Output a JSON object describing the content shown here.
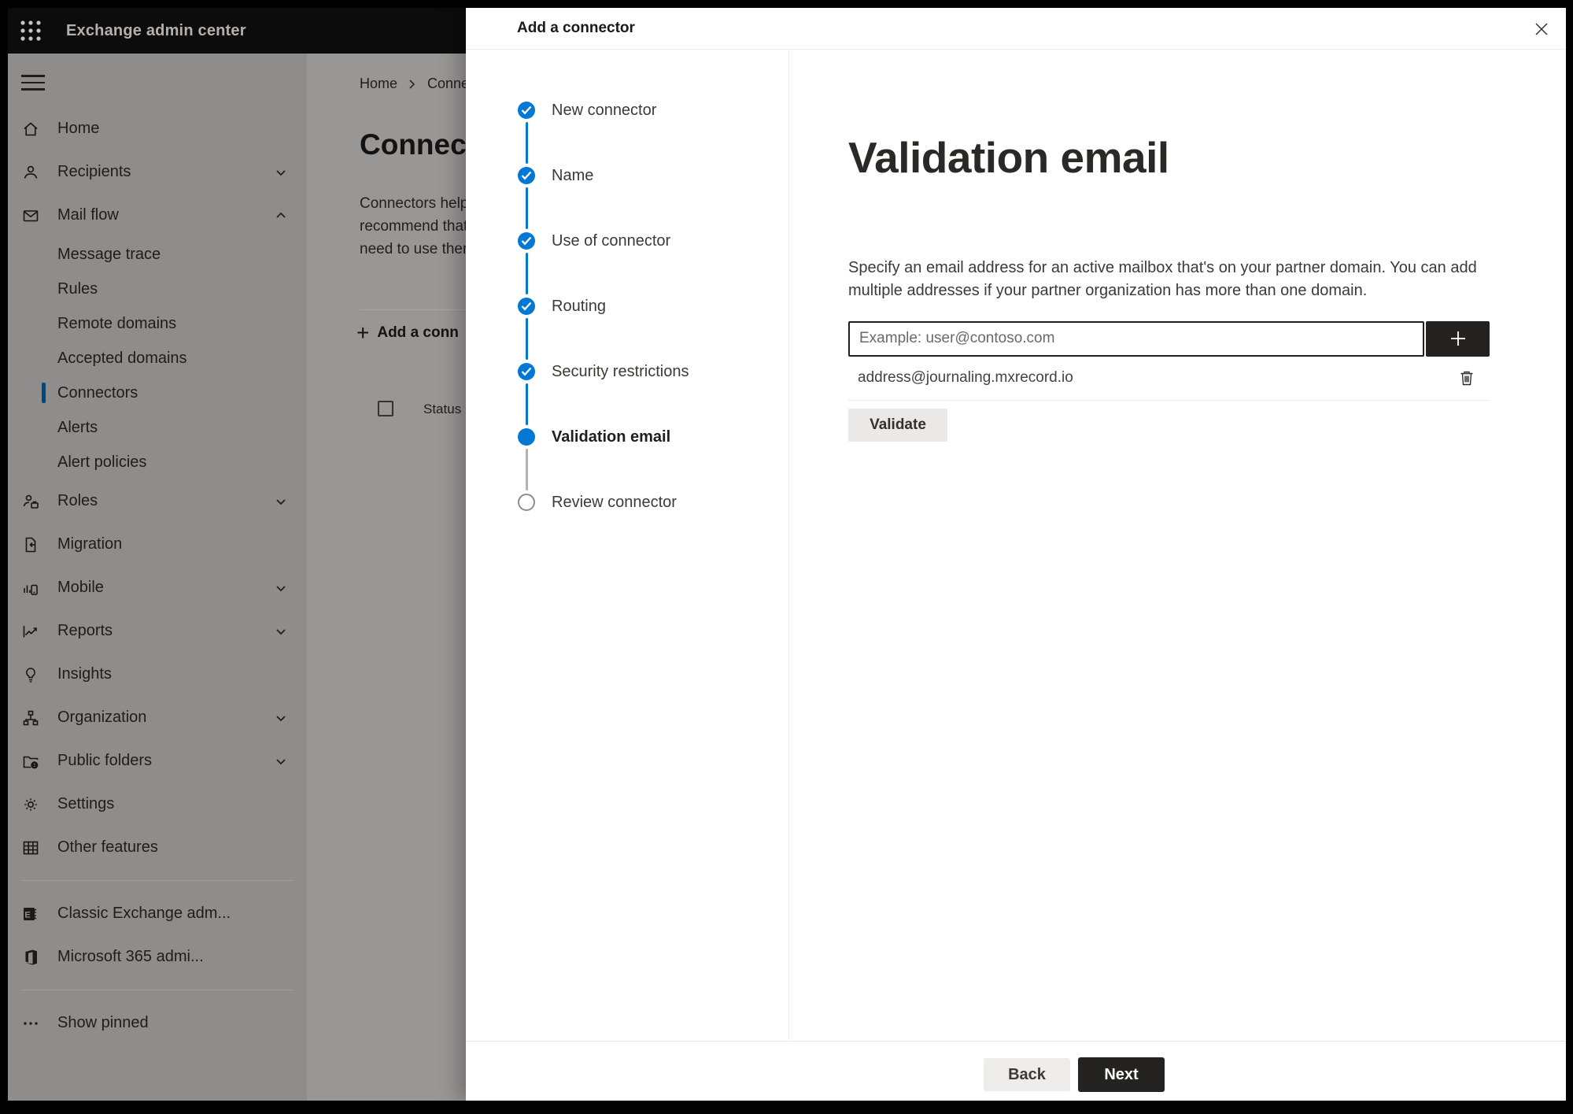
{
  "topbar": {
    "title": "Exchange admin center"
  },
  "sidebar": {
    "items": [
      {
        "label": "Home",
        "icon": "home",
        "type": "top"
      },
      {
        "label": "Recipients",
        "icon": "person",
        "type": "top",
        "chevron": "down"
      },
      {
        "label": "Mail flow",
        "icon": "mail",
        "type": "top",
        "chevron": "up"
      },
      {
        "label": "Message trace",
        "type": "sub"
      },
      {
        "label": "Rules",
        "type": "sub"
      },
      {
        "label": "Remote domains",
        "type": "sub"
      },
      {
        "label": "Accepted domains",
        "type": "sub"
      },
      {
        "label": "Connectors",
        "type": "sub",
        "selected": true
      },
      {
        "label": "Alerts",
        "type": "sub"
      },
      {
        "label": "Alert policies",
        "type": "sub"
      },
      {
        "label": "Roles",
        "icon": "person-briefcase",
        "type": "top",
        "chevron": "down"
      },
      {
        "label": "Migration",
        "icon": "migration",
        "type": "top"
      },
      {
        "label": "Mobile",
        "icon": "mobile",
        "type": "top",
        "chevron": "down"
      },
      {
        "label": "Reports",
        "icon": "chart",
        "type": "top",
        "chevron": "down"
      },
      {
        "label": "Insights",
        "icon": "lightbulb",
        "type": "top"
      },
      {
        "label": "Organization",
        "icon": "org-tree",
        "type": "top",
        "chevron": "down"
      },
      {
        "label": "Public folders",
        "icon": "folder-globe",
        "type": "top",
        "chevron": "down"
      },
      {
        "label": "Settings",
        "icon": "gear",
        "type": "top"
      },
      {
        "label": "Other features",
        "icon": "grid-table",
        "type": "top"
      },
      {
        "type": "divider"
      },
      {
        "label": "Classic Exchange adm...",
        "icon": "exchange-logo",
        "type": "top"
      },
      {
        "label": "Microsoft 365 admi...",
        "icon": "office-logo",
        "type": "top"
      },
      {
        "type": "divider"
      },
      {
        "label": "Show pinned",
        "icon": "ellipsis",
        "type": "top"
      }
    ]
  },
  "page_behind": {
    "breadcrumb": {
      "home": "Home",
      "current": "Conne"
    },
    "title": "Connect",
    "paragraph_lines": [
      "Connectors help",
      "recommend that",
      "need to use ther"
    ],
    "add_button_label": "Add a conn",
    "table_header_status": "Status"
  },
  "panel": {
    "title": "Add a connector",
    "steps": [
      {
        "label": "New connector",
        "status": "done"
      },
      {
        "label": "Name",
        "status": "done"
      },
      {
        "label": "Use of connector",
        "status": "done"
      },
      {
        "label": "Routing",
        "status": "done"
      },
      {
        "label": "Security restrictions",
        "status": "done"
      },
      {
        "label": "Validation email",
        "status": "active"
      },
      {
        "label": "Review connector",
        "status": "pending"
      }
    ],
    "content": {
      "heading": "Validation email",
      "description_lines": [
        "Specify an email address for an active mailbox that's on your partner domain. You can add",
        "multiple addresses if your partner organization has more than one domain."
      ],
      "email_input": {
        "value": "",
        "placeholder": "Example: user@contoso.com"
      },
      "addresses": [
        {
          "email": "address@journaling.mxrecord.io"
        }
      ],
      "validate_button": "Validate"
    },
    "footer": {
      "back": "Back",
      "next": "Next"
    }
  },
  "colors": {
    "accent_blue": "#0078d4",
    "dark_button": "#242322",
    "selected_indicator": "#00487f",
    "panel_bg": "#ffffff",
    "dim_sidebar": "#8e8d8b",
    "dim_page": "#999796",
    "topbar_bg": "#0d0c0c"
  }
}
